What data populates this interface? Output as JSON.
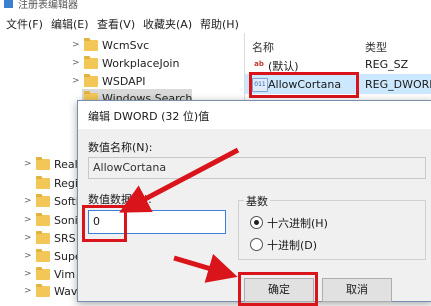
{
  "window": {
    "title": "注册表编辑器"
  },
  "menu": [
    "文件(F)",
    "编辑(E)",
    "查看(V)",
    "收藏夹(A)",
    "帮助(H)"
  ],
  "tree": {
    "subkeys": [
      "WcmSvc",
      "WorkplaceJoin",
      "WSDAPI",
      "Windows Search"
    ],
    "left_items": [
      "Realt",
      "Regi",
      "SoftE",
      "Sonic",
      "SRS I",
      "Supe",
      "Vim",
      "Wave"
    ]
  },
  "values_pane": {
    "headers": {
      "name": "名称",
      "type": "类型"
    },
    "rows": [
      {
        "name": "(默认)",
        "type": "REG_SZ",
        "icon": "ab-string-icon"
      },
      {
        "name": "AllowCortana",
        "type": "REG_DWORD",
        "icon": "binary-value-icon"
      }
    ]
  },
  "dialog": {
    "title": "编辑 DWORD (32 位)值",
    "value_name_label": "数值名称(N):",
    "value_name": "AllowCortana",
    "value_data_label": "数值数据(V):",
    "value_data": "0",
    "base_label": "基数",
    "hex_option": "十六进制(H)",
    "dec_option": "十进制(D)",
    "selected_base": "hex",
    "ok_label": "确定",
    "cancel_label": "取消"
  },
  "colors": {
    "annotation_red": "#d9141b",
    "selection_blue": "#cce8ff",
    "folder_yellow": "#f2c757"
  }
}
